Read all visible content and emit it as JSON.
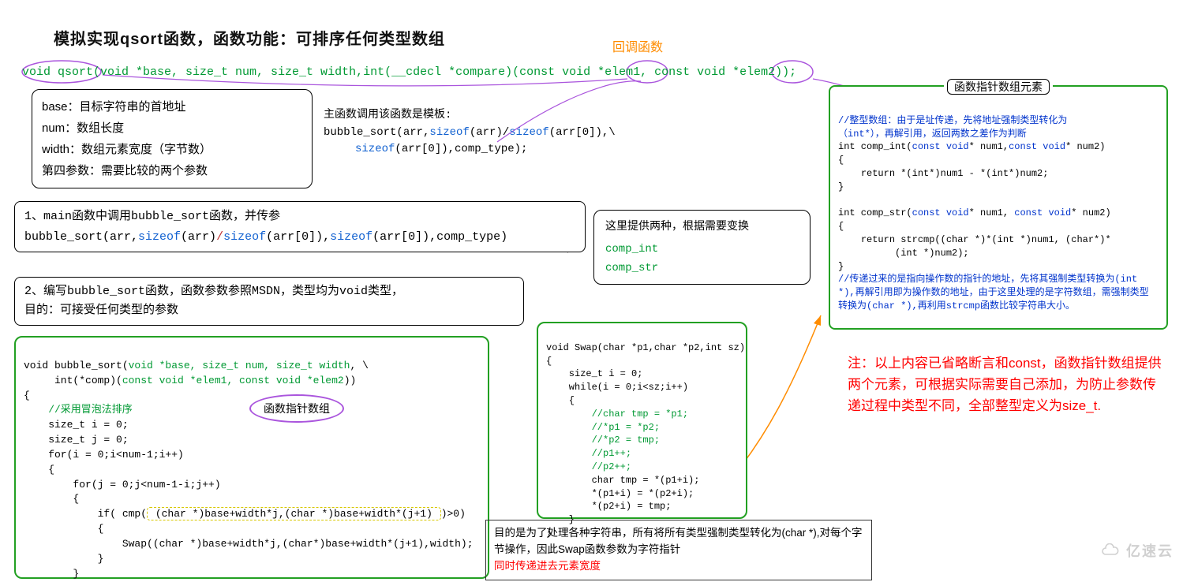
{
  "title": "模拟实现qsort函数，函数功能：可排序任何类型数组",
  "subtitle": "回调函数",
  "signature": "void qsort(void *base, size_t num, size_t width,int(__cdecl *compare)(const void *elem1, const void *elem2));",
  "param_box": {
    "l1": "base：目标字符串的首地址",
    "l2": "num：数组长度",
    "l3": "width：数组元素宽度（字节数）",
    "l4": "第四参数：需要比较的两个参数"
  },
  "template_call": {
    "t1": "主函数调用该函数是模板:",
    "t2_seg1": "bubble_sort(arr,",
    "t2_seg2": "sizeof",
    "t2_seg3": "(arr)/",
    "t2_seg4": "sizeof",
    "t2_seg5": "(arr[0]),\\",
    "t3_seg1": "    sizeof",
    "t3_seg2": "(arr[0]),comp_type);"
  },
  "step1": {
    "l1": "1、main函数中调用bubble_sort函数，并传参",
    "l2_a": "bubble_sort(arr,",
    "l2_b": "sizeof",
    "l2_c": "(arr)",
    "l2_d": "/",
    "l2_e": "sizeof",
    "l2_f": "(arr[0]),",
    "l2_g": "sizeof",
    "l2_h": "(arr[0]),comp_type)"
  },
  "step2": {
    "l1": "2、编写bubble_sort函数，函数参数参照MSDN，类型均为void类型，",
    "l2": "目的：可接受任何类型的参数"
  },
  "bubble_code": {
    "l1a": "void bubble_sort(",
    "l1b": "void *base, size_t num, size_t width",
    "l1c": ", \\",
    "l2a": "     int(*comp)(",
    "l2b": "const void *elem1, const void *elem2",
    "l2c": "))",
    "l3": "{",
    "l4": "    //采用冒泡法排序",
    "l5": "    size_t i = 0;",
    "l6": "    size_t j = 0;",
    "l7": "    for(i = 0;i<num-1;i++)",
    "l8": "    {",
    "l9": "        for(j = 0;j<num-1-i;j++)",
    "l10": "        {",
    "l11a": "            if( cmp(",
    "l11b": " (char *)base+width*j,(char *)base+width*(j+1) ",
    "l11c": ")>0)",
    "l12": "            {",
    "l13": "                Swap((char *)base+width*j,(char*)base+width*(j+1),width);",
    "l14": "            }",
    "l15": "        }"
  },
  "fn_ptr_label": "函数指针数组",
  "callout_comp": {
    "l1": "这里提供两种，根据需要变换",
    "l2": "comp_int",
    "l3": "comp_str"
  },
  "swap_code": {
    "l1": "void Swap(char *p1,char *p2,int sz)",
    "l2": "{",
    "l3": "    size_t i = 0;",
    "l4": "    while(i = 0;i<sz;i++)",
    "l5": "    {",
    "l6": "        //char tmp = *p1;",
    "l7": "        //*p1 = *p2;",
    "l8": "        //*p2 = tmp;",
    "l9": "        //p1++;",
    "l10": "        //p2++;",
    "l11": "        char tmp = *(p1+i);",
    "l12": "        *(p1+i) = *(p2+i);",
    "l13": "        *(p2+i) = tmp;",
    "l14": "    }",
    "l15": "}"
  },
  "fn_ptr_box": {
    "title": "函数指针数组元素",
    "c1": "//整型数组：由于是址传递，先将地址强制类型转化为",
    "c2": "（int*），再解引用，返回两数之差作为判断",
    "l1a": "int comp_int(",
    "l1b": "const void",
    "l1c": "* num1,",
    "l1d": "const void",
    "l1e": "* num2)",
    "l2": "{",
    "l3": "    return *(int*)num1 - *(int*)num2;",
    "l4": "}",
    "gap": "",
    "l5a": "int comp_str(",
    "l5b": "const void",
    "l5c": "* num1, ",
    "l5d": "const void",
    "l5e": "* num2)",
    "l6": "{",
    "l7": "    return strcmp((char *)*(int *)num1, (char*)*",
    "l8": "          (int *)num2);",
    "l9": "}",
    "c3": "//传递过来的是指向操作数的指针的地址，先将其强制类型转换为(int *),再解引用即为操作数的地址，由于这里处理的是字符数组，需强制类型转换为(char *),再利用strcmp函数比较字符串大小。"
  },
  "red_note": "注：以上内容已省略断言和const，函数指针数组提供两个元素，可根据实际需要自己添加，为防止参数传递过程中类型不同，全部整型定义为size_t.",
  "explain": {
    "l1": "目的是为了处理各种字符串，所有将所有类型强制类型转化为(char *),对每个字节操作，因此Swap函数参数为字符指针",
    "l2": "同时传递进去元素宽度"
  },
  "watermark": "亿速云"
}
